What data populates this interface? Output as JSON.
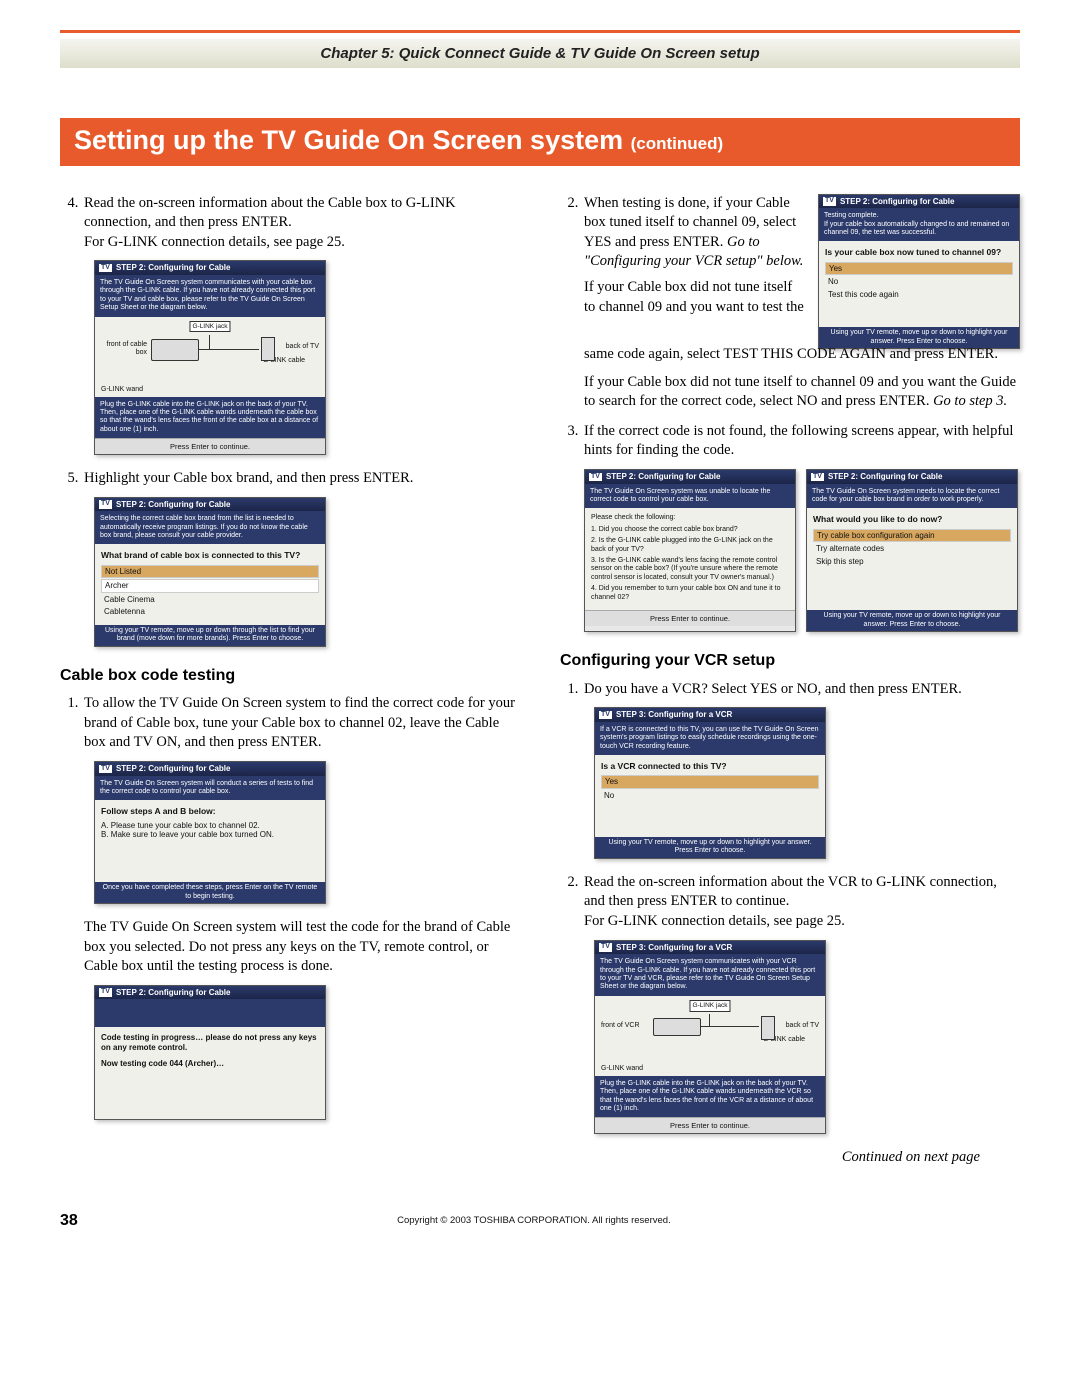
{
  "chapter": "Chapter 5: Quick Connect Guide & TV Guide On Screen setup",
  "title_main": "Setting up the TV Guide On Screen system",
  "title_suffix": "(continued)",
  "left": {
    "step4_a": "Read the on-screen information about the Cable box to G-LINK connection, and then press ENTER.",
    "step4_b": "For G-LINK connection details, see page 25.",
    "dlg_glink": {
      "title": "STEP 2: Configuring for Cable",
      "logo": "TV",
      "top": "The TV Guide On Screen system communicates with your cable box through the G-LINK cable. If you have not already connected this port to your TV and cable box, please refer to the TV Guide On Screen Setup Sheet or the diagram below.",
      "diag": {
        "front": "front of cable box",
        "jack": "G-LINK jack",
        "back": "back of TV",
        "cable": "G-LINK cable",
        "wand": "G-LINK wand"
      },
      "mid": "Plug the G-LINK cable into the G-LINK jack on the back of your TV. Then, place one of the G-LINK cable wands underneath the cable box so that the wand's lens faces the front of the cable box at a distance of about one (1) inch.",
      "foot": "Press Enter to continue."
    },
    "step5": "Highlight your Cable box brand, and then press ENTER.",
    "dlg_brand": {
      "title": "STEP 2: Configuring for Cable",
      "top": "Selecting the correct cable box brand from the list is needed to automatically receive program listings. If you do not know the cable box brand, please consult your cable provider.",
      "question": "What brand of cable box is connected to this TV?",
      "opts": [
        "Not Listed",
        "Archer",
        "Cable Cinema",
        "Cabletenna"
      ],
      "foot": "Using your TV remote, move up or down through the list to find your brand (move down for more brands). Press Enter to choose."
    },
    "sub_cable_test": "Cable box code testing",
    "test_step1": "To allow the TV Guide On Screen system to find the correct code for your brand of Cable box, tune your Cable box to channel 02, leave the Cable box and TV ON, and then press ENTER.",
    "dlg_follow": {
      "title": "STEP 2: Configuring for Cable",
      "top": "The TV Guide On Screen system will conduct a series of tests to find the correct code to control your cable box.",
      "question": "Follow steps A and B below:",
      "a": "A.  Please tune your cable box to channel 02.",
      "b": "B.  Make sure to leave your cable box turned ON.",
      "foot": "Once you have completed these steps, press Enter on the TV remote to begin testing."
    },
    "test_note": "The TV Guide On Screen system will test the code for the brand of Cable box you selected. Do not press any keys on the TV, remote control, or Cable box until the testing process is done.",
    "dlg_testing": {
      "title": "STEP 2: Configuring for Cable",
      "line1": "Code testing in progress… please do not press any keys on any remote control.",
      "line2": "Now testing code 044 (Archer)…"
    }
  },
  "right": {
    "step2_a": "When testing is done, if your Cable box tuned itself to channel 09, select YES and press ENTER.",
    "step2_i": "Go to \"Configuring your VCR setup\" below.",
    "step2_b": "If your Cable box did not tune itself to channel 09 and you want to test the same code again, select TEST THIS CODE AGAIN and press ENTER.",
    "step2_c": "If your Cable box did not tune itself to channel 09 and you want the Guide to search for the correct code, select NO and press ENTER. ",
    "step2_c_i": "Go to step 3.",
    "dlg_tuned": {
      "title": "STEP 2: Configuring for Cable",
      "top": "Testing complete.\nIf your cable box automatically changed to and remained on channel 09, the test was successful.",
      "question": "Is your cable box now tuned to channel 09?",
      "opts": [
        "Yes",
        "No",
        "Test this code again"
      ],
      "foot": "Using your TV remote, move up or down to highlight your answer.  Press Enter to choose."
    },
    "step3": "If the correct code is not found, the following screens appear, with helpful hints for finding the code.",
    "dlg_hints": {
      "title": "STEP 2: Configuring for Cable",
      "top": "The TV Guide On Screen system was unable to locate the correct code to control your cable box.",
      "line_head": "Please check the following:",
      "l1": "1.    Did you choose the correct cable box brand?",
      "l2": "2.    Is the G-LINK cable plugged into the G-LINK jack on the back of your TV?",
      "l3": "3.    Is the G-LINK cable wand's lens facing the remote control sensor on the cable box? (If you're unsure where the remote control sensor is located, consult your TV owner's manual.)",
      "l4": "4.    Did you remember to turn your cable box ON and tune it to channel 02?",
      "foot": "Press Enter to continue."
    },
    "dlg_next": {
      "title": "STEP 2: Configuring for Cable",
      "top": "The TV Guide On Screen system needs to locate the correct code for your cable box brand in order to work properly.",
      "question": "What would you like to do now?",
      "opts": [
        "Try cable box configuration again",
        "Try alternate codes",
        "Skip this step"
      ],
      "foot": "Using your TV remote, move up or down to highlight your answer.  Press Enter to choose."
    },
    "sub_vcr": "Configuring your VCR setup",
    "vcr_step1": "Do you have a VCR? Select YES or NO, and then press ENTER.",
    "dlg_vcr_q": {
      "title": "STEP 3: Configuring for a VCR",
      "top": "If a VCR is connected to this TV, you can use the TV Guide On Screen system's program listings to easily schedule recordings using the one-touch VCR recording feature.",
      "question": "Is a VCR connected to this TV?",
      "opts": [
        "Yes",
        "No"
      ],
      "foot": "Using your TV remote, move up or down to highlight your answer.  Press Enter to choose."
    },
    "vcr_step2_a": "Read the on-screen information about the VCR to G-LINK connection, and then press ENTER to continue.",
    "vcr_step2_b": "For G-LINK connection details, see page 25.",
    "dlg_vcr_glink": {
      "title": "STEP 3: Configuring for a VCR",
      "top": "The TV Guide On Screen system communicates with your VCR through the G-LINK cable. If you have not already connected this port to your TV and VCR, please refer to the TV Guide On Screen Setup Sheet or the diagram below.",
      "diag": {
        "front": "front of VCR",
        "jack": "G-LINK jack",
        "back": "back of TV",
        "cable": "G-LINK cable",
        "wand": "G-LINK wand"
      },
      "mid": "Plug the G-LINK cable into the G-LINK jack on the back of your TV. Then, place one of the G-LINK cable wands underneath the VCR so that the wand's lens faces the front of the VCR at a distance of about one (1) inch.",
      "foot": "Press Enter to continue."
    },
    "continued": "Continued on next page"
  },
  "footer": {
    "page": "38",
    "copyright": "Copyright © 2003 TOSHIBA CORPORATION. All rights reserved."
  }
}
